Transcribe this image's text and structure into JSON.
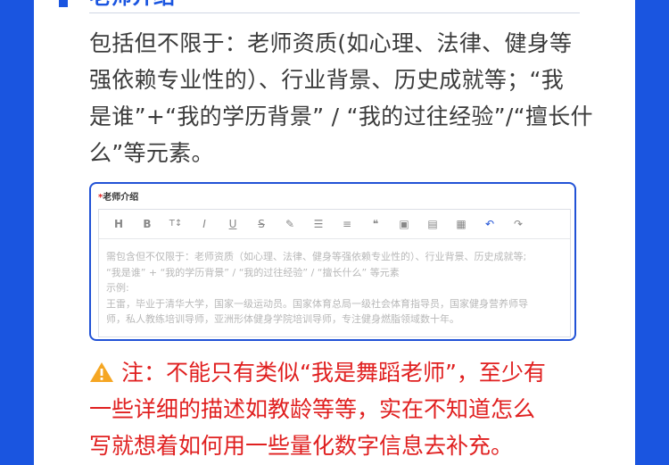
{
  "section": {
    "heading": "老师介绍",
    "description_lines": [
      "包括但不限于：老师资质(如心理、法律、健身等",
      "强依赖专业性的）、行业背景、历史成就等；“我",
      "是谁”+“我的学历背景” / “我的过往经验”/“擅长什",
      "么”等元素。"
    ]
  },
  "form": {
    "required_mark": "*",
    "label": "老师介绍",
    "toolbar": [
      {
        "icon": "heading-icon",
        "glyph": "H"
      },
      {
        "icon": "bold-icon",
        "glyph": "B"
      },
      {
        "icon": "font-size-icon",
        "glyph": "T↕"
      },
      {
        "icon": "italic-icon",
        "glyph": "I"
      },
      {
        "icon": "underline-icon",
        "glyph": "U"
      },
      {
        "icon": "strikethrough-icon",
        "glyph": "S"
      },
      {
        "icon": "highlight-pen-icon",
        "glyph": "✎"
      },
      {
        "icon": "bullet-list-icon",
        "glyph": "☰"
      },
      {
        "icon": "align-icon",
        "glyph": "≡"
      },
      {
        "icon": "quote-icon",
        "glyph": "❝"
      },
      {
        "icon": "image-icon",
        "glyph": "▣"
      },
      {
        "icon": "file-icon",
        "glyph": "▤"
      },
      {
        "icon": "table-icon",
        "glyph": "▦"
      },
      {
        "icon": "undo-icon",
        "glyph": "↶"
      },
      {
        "icon": "redo-icon",
        "glyph": "↷"
      }
    ],
    "placeholder_lines": [
      "需包含但不仅限于：老师资质（如心理、法律、健身等强依赖专业性的）、行业背景、历史成就等;",
      "“我是谁” + “我的学历背景” / “我的过往经验” / “擅长什么” 等元素",
      "示例:",
      "王雷，毕业于清华大学，国家一级运动员。国家体育总局一级社会体育指导员，国家健身营养师导",
      "师，私人教练培训导师，亚洲形体健身学院培训导师，专注健身燃脂领域数十年。"
    ]
  },
  "warning": {
    "lines": [
      "注：不能只有类似“我是舞蹈老师”，至少有",
      "一些详细的描述如教龄等等，实在不知道怎么",
      "写就想着如何用一些量化数字信息去补充。"
    ]
  },
  "colors": {
    "background": "#1a55e0",
    "accent": "#2152d6",
    "warning": "#e02020",
    "warning_icon": "#f5a623"
  }
}
